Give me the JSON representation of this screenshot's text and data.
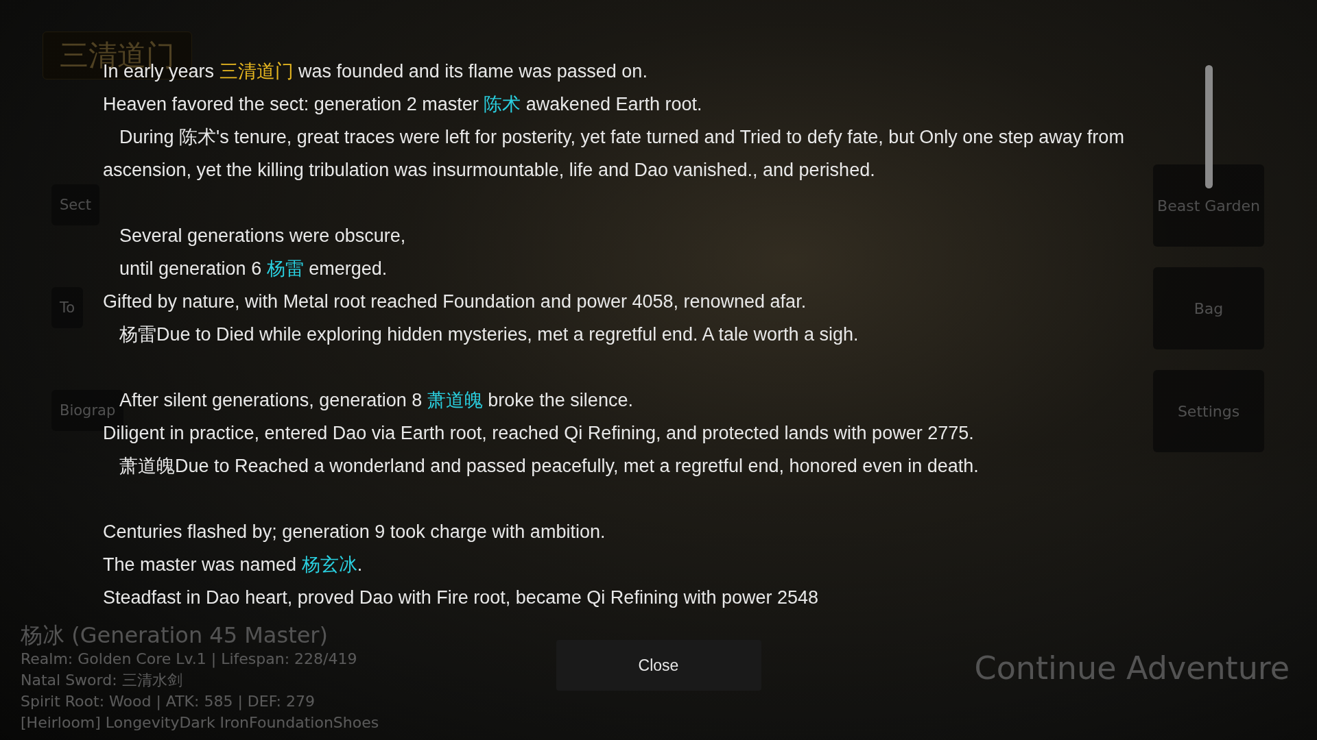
{
  "background": {
    "sect_title": "三清道门",
    "left_buttons": [
      "Sect",
      "To",
      "Biograp"
    ],
    "right_buttons": [
      "Beast Garden",
      "Bag",
      "Settings"
    ],
    "master": {
      "title": "杨冰 (Generation 45 Master)",
      "stats": [
        "Realm: Golden Core Lv.1 | Lifespan: 228/419",
        "Natal Sword: 三清水剑",
        "Spirit Root: Wood | ATK: 585 | DEF: 279",
        "[Heirloom] LongevityDark IronFoundationShoes"
      ]
    },
    "continue_button": "Continue Adventure"
  },
  "story": {
    "paragraphs": [
      [
        {
          "indent": false,
          "parts": [
            {
              "kind": "plain",
              "text": "In early years "
            },
            {
              "kind": "sect",
              "text": "三清道门"
            },
            {
              "kind": "plain",
              "text": " was founded and its flame was passed on."
            }
          ]
        },
        {
          "indent": false,
          "parts": [
            {
              "kind": "plain",
              "text": "Heaven favored the sect: generation 2 master "
            },
            {
              "kind": "person",
              "text": "陈术"
            },
            {
              "kind": "plain",
              "text": " awakened Earth root."
            }
          ]
        },
        {
          "indent": true,
          "parts": [
            {
              "kind": "plain",
              "text": "During 陈术's tenure, great traces were left for posterity, yet fate turned and Tried to defy fate, but Only one step away from ascension, yet the killing tribulation was insurmountable, life and Dao vanished., and perished."
            }
          ]
        }
      ],
      [
        {
          "indent": true,
          "parts": [
            {
              "kind": "plain",
              "text": "Several generations were obscure,"
            }
          ]
        },
        {
          "indent": true,
          "parts": [
            {
              "kind": "plain",
              "text": "until generation 6 "
            },
            {
              "kind": "person",
              "text": "杨雷"
            },
            {
              "kind": "plain",
              "text": " emerged."
            }
          ]
        },
        {
          "indent": false,
          "parts": [
            {
              "kind": "plain",
              "text": "Gifted by nature, with Metal root reached Foundation and power 4058, renowned afar."
            }
          ]
        },
        {
          "indent": true,
          "parts": [
            {
              "kind": "plain",
              "text": "杨雷Due to Died while exploring hidden mysteries, met a regretful end. A tale worth a sigh."
            }
          ]
        }
      ],
      [
        {
          "indent": true,
          "parts": [
            {
              "kind": "plain",
              "text": "After silent generations, generation 8 "
            },
            {
              "kind": "person",
              "text": "萧道魄"
            },
            {
              "kind": "plain",
              "text": " broke the silence."
            }
          ]
        },
        {
          "indent": false,
          "parts": [
            {
              "kind": "plain",
              "text": "Diligent in practice, entered Dao via Earth root, reached Qi Refining, and protected lands with power 2775."
            }
          ]
        },
        {
          "indent": true,
          "parts": [
            {
              "kind": "plain",
              "text": "萧道魄Due to Reached a wonderland and passed peacefully, met a regretful end, honored even in death."
            }
          ]
        }
      ],
      [
        {
          "indent": false,
          "parts": [
            {
              "kind": "plain",
              "text": "Centuries flashed by; generation 9 took charge with ambition."
            }
          ]
        },
        {
          "indent": false,
          "parts": [
            {
              "kind": "plain",
              "text": "The master was named "
            },
            {
              "kind": "person",
              "text": "杨玄冰"
            },
            {
              "kind": "plain",
              "text": "."
            }
          ]
        },
        {
          "indent": false,
          "parts": [
            {
              "kind": "plain",
              "text": "Steadfast in Dao heart, proved Dao with Fire root, became Qi Refining with power 2548"
            }
          ]
        }
      ]
    ]
  },
  "close_button": "Close"
}
